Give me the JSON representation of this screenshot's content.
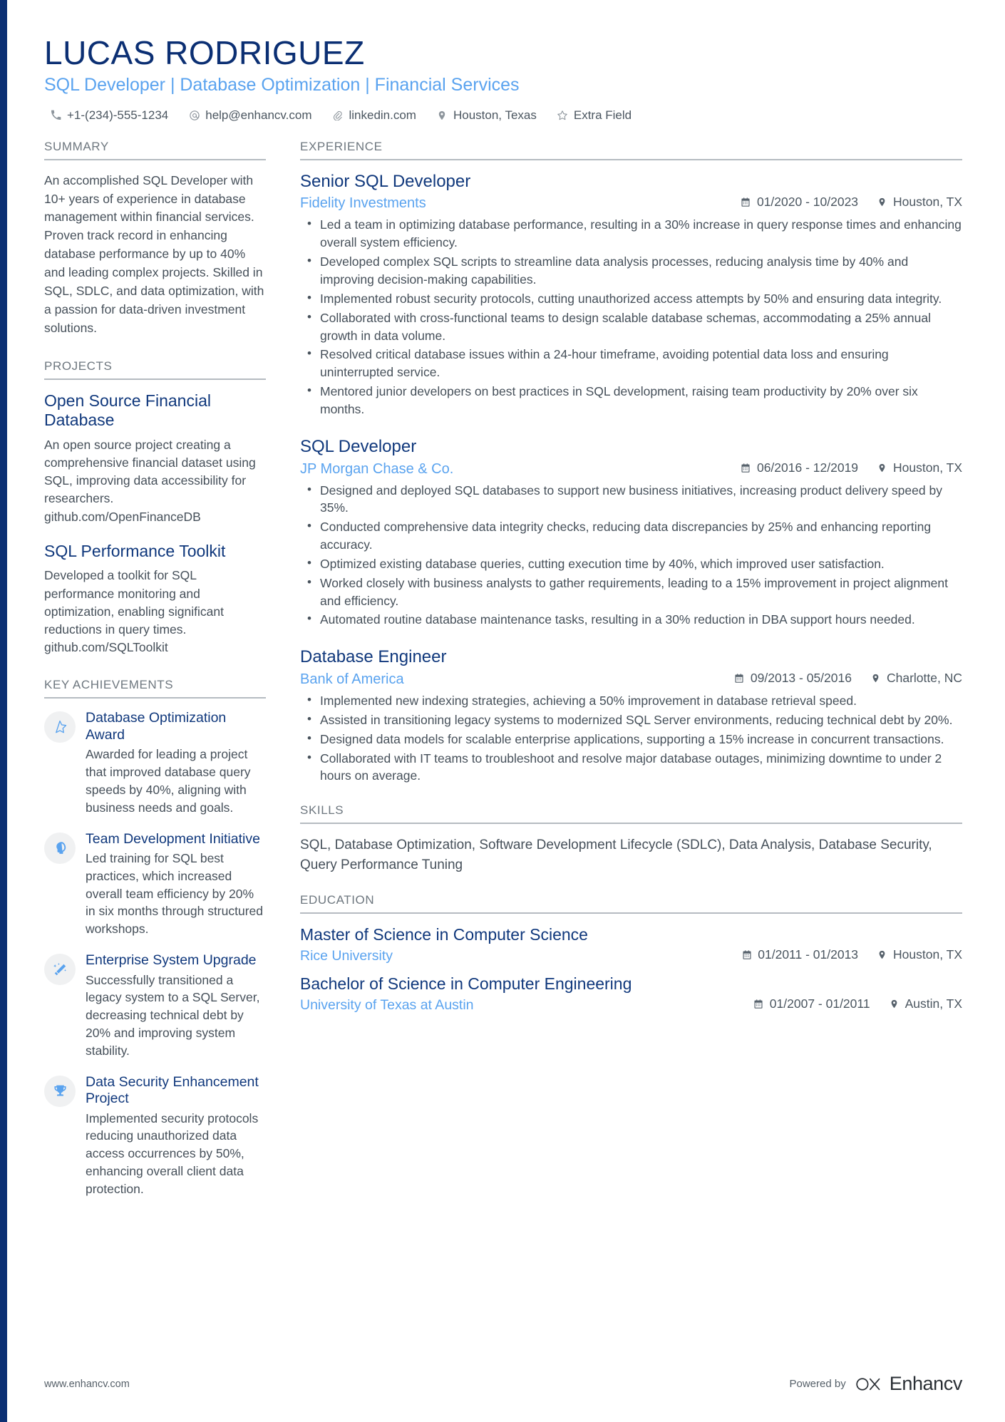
{
  "header": {
    "name": "LUCAS RODRIGUEZ",
    "headline": "SQL Developer | Database Optimization | Financial Services",
    "contacts": [
      {
        "icon": "phone-icon",
        "text": "+1-(234)-555-1234"
      },
      {
        "icon": "email-icon",
        "text": "help@enhancv.com"
      },
      {
        "icon": "link-icon",
        "text": "linkedin.com"
      },
      {
        "icon": "location-pin-icon",
        "text": "Houston, Texas"
      },
      {
        "icon": "star-icon",
        "text": "Extra Field"
      }
    ]
  },
  "left": {
    "summary": {
      "title": "SUMMARY",
      "text": "An accomplished SQL Developer with 10+ years of experience in database management within financial services. Proven track record in enhancing database performance by up to 40% and leading complex projects. Skilled in SQL, SDLC, and data optimization, with a passion for data-driven investment solutions."
    },
    "projects": {
      "title": "PROJECTS",
      "items": [
        {
          "title": "Open Source Financial Database",
          "description": "An open source project creating a comprehensive financial dataset using SQL, improving data accessibility for researchers.",
          "link": "github.com/OpenFinanceDB"
        },
        {
          "title": "SQL Performance Toolkit",
          "description": "Developed a toolkit for SQL performance monitoring and optimization, enabling significant reductions in query times.",
          "link": "github.com/SQLToolkit"
        }
      ]
    },
    "achievements": {
      "title": "KEY ACHIEVEMENTS",
      "items": [
        {
          "icon": "star-outline-icon",
          "title": "Database Optimization Award",
          "description": "Awarded for leading a project that improved database query speeds by 40%, aligning with business needs and goals."
        },
        {
          "icon": "head-profile-icon",
          "title": "Team Development Initiative",
          "description": "Led training for SQL best practices, which increased overall team efficiency by 20% in six months through structured workshops."
        },
        {
          "icon": "magic-wand-icon",
          "title": "Enterprise System Upgrade",
          "description": "Successfully transitioned a legacy system to a SQL Server, decreasing technical debt by 20% and improving system stability."
        },
        {
          "icon": "trophy-icon",
          "title": "Data Security Enhancement Project",
          "description": "Implemented security protocols reducing unauthorized data access occurrences by 50%, enhancing overall client data protection."
        }
      ]
    }
  },
  "right": {
    "experience": {
      "title": "EXPERIENCE",
      "jobs": [
        {
          "title": "Senior SQL Developer",
          "company": "Fidelity Investments",
          "dates": "01/2020 - 10/2023",
          "location": "Houston, TX",
          "bullets": [
            "Led a team in optimizing database performance, resulting in a 30% increase in query response times and enhancing overall system efficiency.",
            "Developed complex SQL scripts to streamline data analysis processes, reducing analysis time by 40% and improving decision-making capabilities.",
            "Implemented robust security protocols, cutting unauthorized access attempts by 50% and ensuring data integrity.",
            "Collaborated with cross-functional teams to design scalable database schemas, accommodating a 25% annual growth in data volume.",
            "Resolved critical database issues within a 24-hour timeframe, avoiding potential data loss and ensuring uninterrupted service.",
            "Mentored junior developers on best practices in SQL development, raising team productivity by 20% over six months."
          ]
        },
        {
          "title": "SQL Developer",
          "company": "JP Morgan Chase & Co.",
          "dates": "06/2016 - 12/2019",
          "location": "Houston, TX",
          "bullets": [
            "Designed and deployed SQL databases to support new business initiatives, increasing product delivery speed by 35%.",
            "Conducted comprehensive data integrity checks, reducing data discrepancies by 25% and enhancing reporting accuracy.",
            "Optimized existing database queries, cutting execution time by 40%, which improved user satisfaction.",
            "Worked closely with business analysts to gather requirements, leading to a 15% improvement in project alignment and efficiency.",
            "Automated routine database maintenance tasks, resulting in a 30% reduction in DBA support hours needed."
          ]
        },
        {
          "title": "Database Engineer",
          "company": "Bank of America",
          "dates": "09/2013 - 05/2016",
          "location": "Charlotte, NC",
          "bullets": [
            "Implemented new indexing strategies, achieving a 50% improvement in database retrieval speed.",
            "Assisted in transitioning legacy systems to modernized SQL Server environments, reducing technical debt by 20%.",
            "Designed data models for scalable enterprise applications, supporting a 15% increase in concurrent transactions.",
            "Collaborated with IT teams to troubleshoot and resolve major database outages, minimizing downtime to under 2 hours on average."
          ]
        }
      ]
    },
    "skills": {
      "title": "SKILLS",
      "text": "SQL, Database Optimization, Software Development Lifecycle (SDLC), Data Analysis, Database Security, Query Performance Tuning"
    },
    "education": {
      "title": "EDUCATION",
      "items": [
        {
          "degree": "Master of Science in Computer Science",
          "school": "Rice University",
          "dates": "01/2011 - 01/2013",
          "location": "Houston, TX"
        },
        {
          "degree": "Bachelor of Science in Computer Engineering",
          "school": "University of Texas at Austin",
          "dates": "01/2007 - 01/2011",
          "location": "Austin, TX"
        }
      ]
    }
  },
  "footer": {
    "url": "www.enhancv.com",
    "powered_by": "Powered by",
    "brand": "Enhancv"
  },
  "colors": {
    "navy": "#0b2f73",
    "title_navy": "#10387c",
    "accent_blue": "#5aa3ef",
    "body_text": "#46505a",
    "section_label": "#6e777f",
    "rule": "#b5bbc1"
  }
}
